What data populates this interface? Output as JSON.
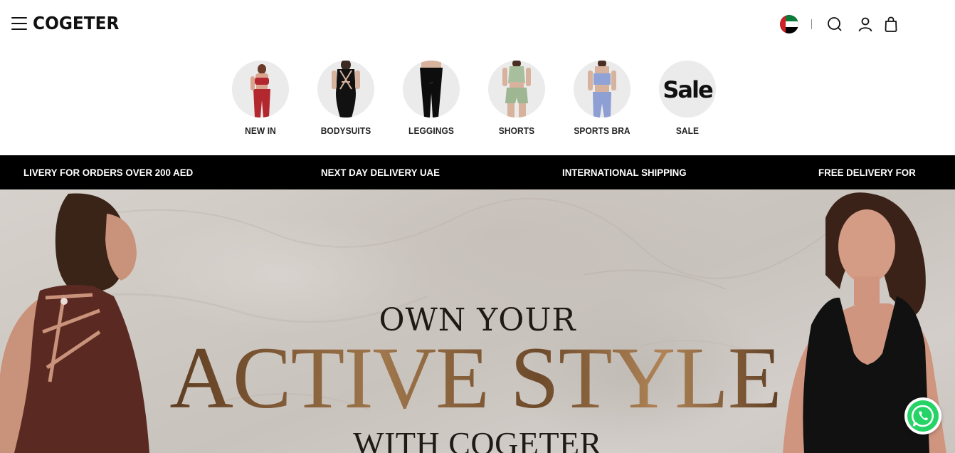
{
  "header": {
    "logo": "COGETER",
    "menu_icon": "hamburger-menu-icon",
    "country_flag": "uae-flag-icon",
    "icons": [
      "search-icon",
      "user-icon",
      "shopping-bag-icon"
    ]
  },
  "categories": [
    {
      "label": "NEW IN",
      "icon": "red-set-image"
    },
    {
      "label": "BODYSUITS",
      "icon": "black-bodysuit-image"
    },
    {
      "label": "LEGGINGS",
      "icon": "black-leggings-image"
    },
    {
      "label": "SHORTS",
      "icon": "green-shorts-image"
    },
    {
      "label": "SPORTS BRA",
      "icon": "blue-sports-bra-image"
    },
    {
      "label": "SALE",
      "image_text": "Sale"
    }
  ],
  "promo_strip": {
    "items": [
      "LIVERY FOR ORDERS OVER 200 AED",
      "NEXT DAY DELIVERY UAE",
      "INTERNATIONAL SHIPPING",
      "FREE DELIVERY FOR"
    ]
  },
  "hero": {
    "line1": "OWN YOUR",
    "line2": "ACTIVE STYLE",
    "line3": "WITH COGETER"
  },
  "whatsapp": {
    "icon": "whatsapp-icon",
    "color": "#25d366"
  },
  "colors": {
    "strip_bg": "#000000",
    "hero_gold": "#8a6239"
  }
}
